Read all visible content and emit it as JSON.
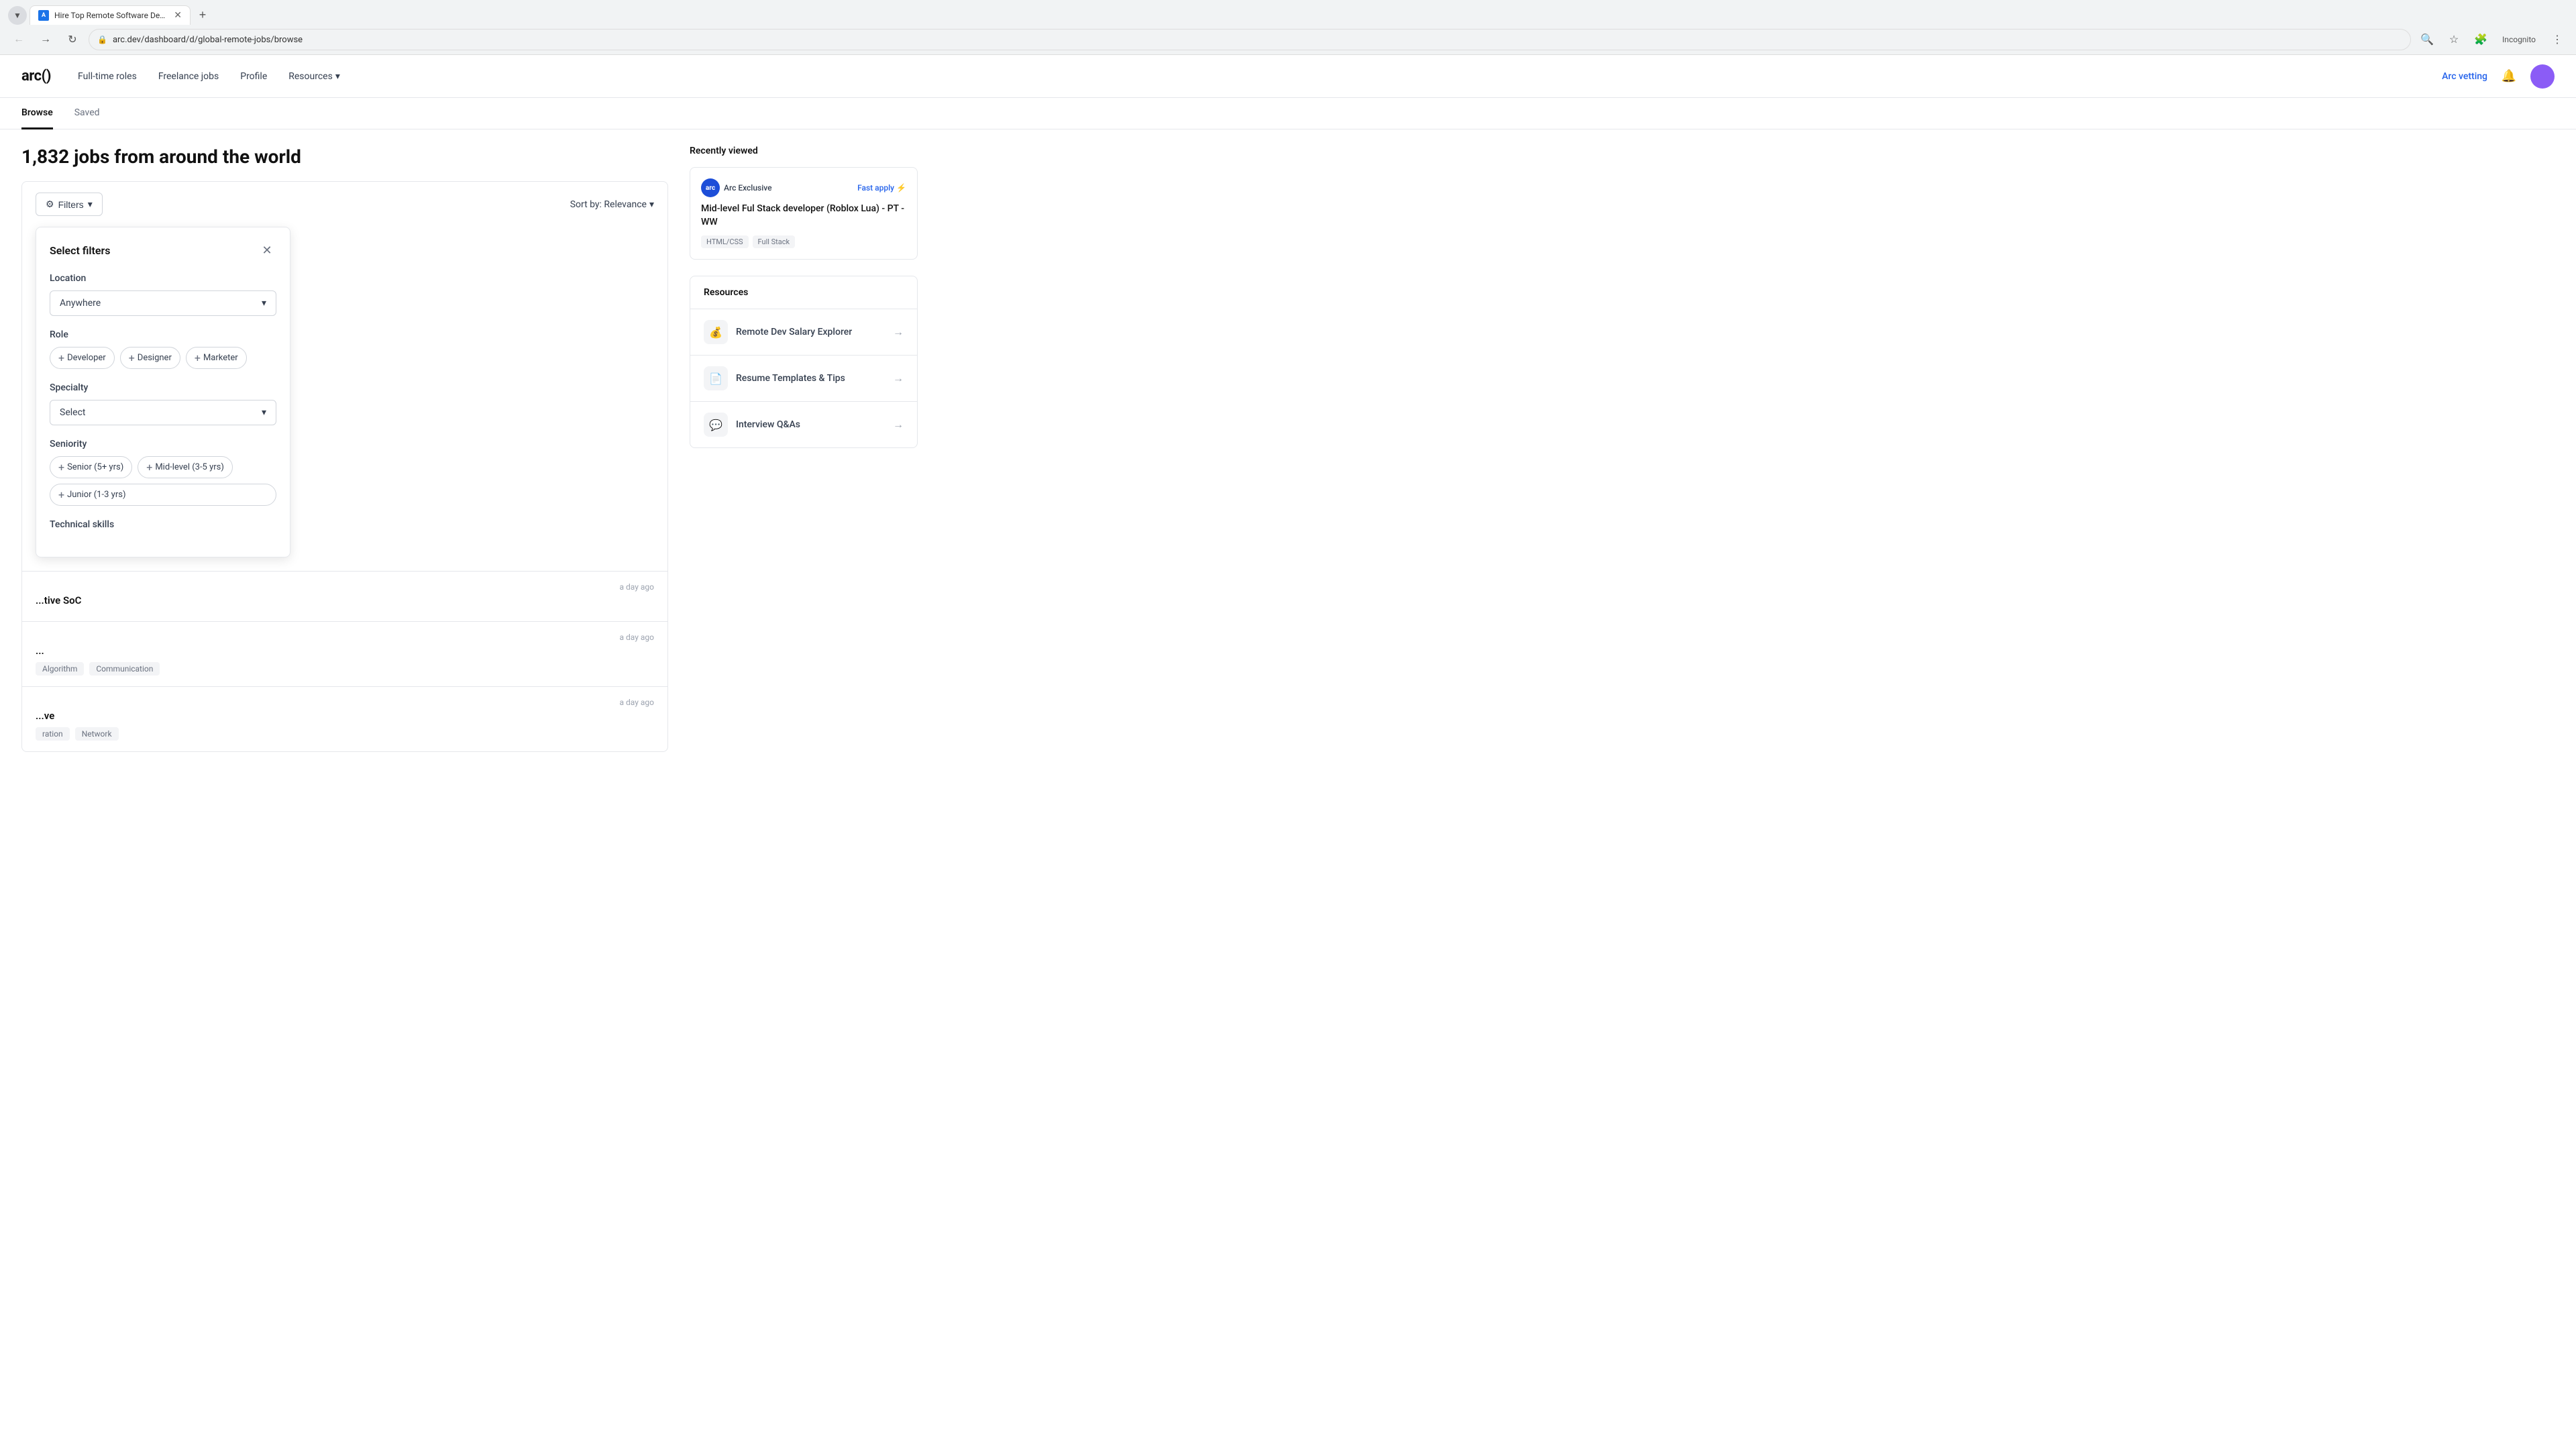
{
  "browser": {
    "tab": {
      "title": "Hire Top Remote Software Dev...",
      "favicon": "A"
    },
    "address": "arc.dev/dashboard/d/global-remote-jobs/browse"
  },
  "header": {
    "logo": "arc()",
    "nav": [
      {
        "label": "Full-time roles"
      },
      {
        "label": "Freelance jobs"
      },
      {
        "label": "Profile"
      },
      {
        "label": "Resources",
        "hasDropdown": true
      }
    ],
    "arc_vetting": "Arc vetting",
    "sub_nav": [
      {
        "label": "Browse",
        "active": true
      },
      {
        "label": "Saved",
        "active": false
      }
    ]
  },
  "main": {
    "page_title": "1,832 jobs from around the world",
    "toolbar": {
      "filters_label": "Filters",
      "sort_label": "Sort by: Relevance"
    },
    "filter_panel": {
      "title": "Select filters",
      "location": {
        "label": "Location",
        "value": "Anywhere",
        "placeholder": "Anywhere"
      },
      "role": {
        "label": "Role",
        "chips": [
          {
            "label": "Developer"
          },
          {
            "label": "Designer"
          },
          {
            "label": "Marketer"
          }
        ]
      },
      "specialty": {
        "label": "Specialty",
        "value": "Select",
        "placeholder": "Select"
      },
      "seniority": {
        "label": "Seniority",
        "chips": [
          {
            "label": "Senior (5+ yrs)"
          },
          {
            "label": "Mid-level (3-5 yrs)"
          },
          {
            "label": "Junior (1-3 yrs)"
          }
        ]
      },
      "technical_skills_label": "Technical skills"
    },
    "jobs": [
      {
        "time": "a day ago",
        "title": "...tive SoC",
        "tags": []
      },
      {
        "time": "a day ago",
        "title": "...",
        "tags": [
          "Algorithm",
          "Communication"
        ]
      },
      {
        "time": "a day ago",
        "title": "...ve",
        "tags": [
          "ration",
          "Network"
        ]
      }
    ]
  },
  "sidebar": {
    "recently_viewed_title": "Recently viewed",
    "job_card": {
      "badge": "Arc Exclusive",
      "fast_apply": "Fast apply",
      "title": "Mid-level Ful Stack developer (Roblox Lua) - PT - WW",
      "tags": [
        "HTML/CSS",
        "Full Stack"
      ]
    },
    "resources_title": "Resources",
    "resources": [
      {
        "icon": "💰",
        "label": "Remote Dev Salary Explorer",
        "arrow": "→"
      },
      {
        "icon": "📄",
        "label": "Resume Templates & Tips",
        "arrow": "→"
      },
      {
        "icon": "💬",
        "label": "Interview Q&As",
        "arrow": "→"
      }
    ]
  }
}
